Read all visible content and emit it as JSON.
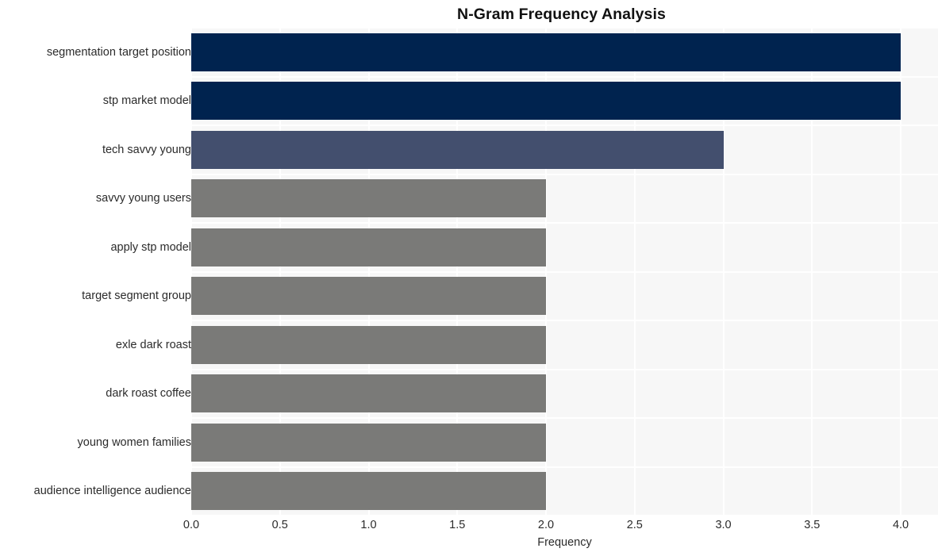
{
  "chart_data": {
    "type": "bar",
    "orientation": "horizontal",
    "title": "N-Gram Frequency Analysis",
    "xlabel": "Frequency",
    "ylabel": "",
    "categories": [
      "segmentation target position",
      "stp market model",
      "tech savvy young",
      "savvy young users",
      "apply stp model",
      "target segment group",
      "exle dark roast",
      "dark roast coffee",
      "young women families",
      "audience intelligence audience"
    ],
    "values": [
      4,
      4,
      3,
      2,
      2,
      2,
      2,
      2,
      2,
      2
    ],
    "bar_colors": [
      "#00234f",
      "#00234f",
      "#434f6e",
      "#7a7a78",
      "#7a7a78",
      "#7a7a78",
      "#7a7a78",
      "#7a7a78",
      "#7a7a78",
      "#7a7a78"
    ],
    "xlim": [
      0,
      4.21
    ],
    "xticks": [
      0.0,
      0.5,
      1.0,
      1.5,
      2.0,
      2.5,
      3.0,
      3.5,
      4.0
    ],
    "xtick_labels": [
      "0.0",
      "0.5",
      "1.0",
      "1.5",
      "2.0",
      "2.5",
      "3.0",
      "3.5",
      "4.0"
    ],
    "grid": true,
    "grid_color": "#ffffff",
    "plot_background": "#f7f7f7",
    "figure_background": "#ffffff",
    "legend": null
  }
}
